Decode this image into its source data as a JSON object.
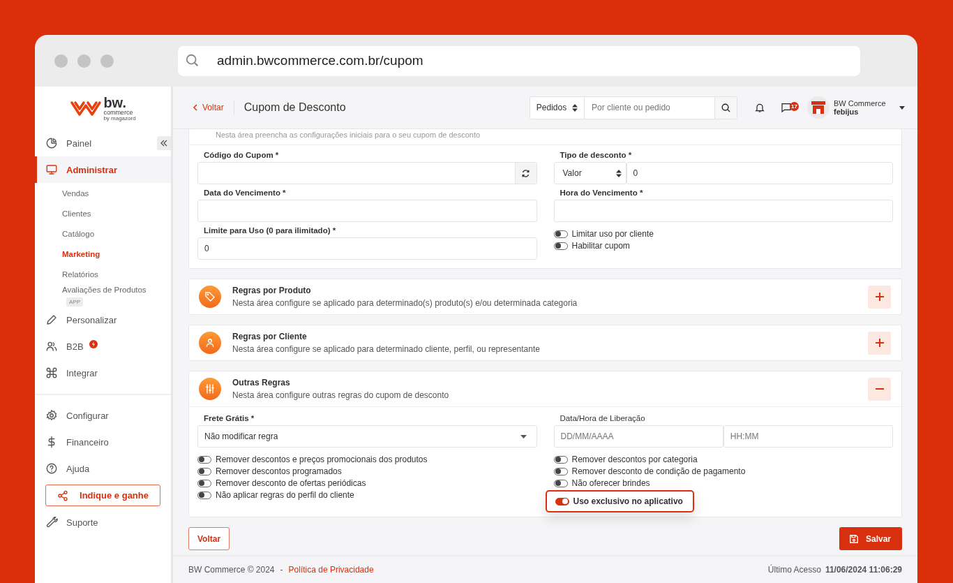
{
  "browser": {
    "url": "admin.bwcommerce.com.br/cupom"
  },
  "logo": {
    "name": "bw.",
    "tagline": "commerce",
    "byline": "by magazord"
  },
  "sidebar": {
    "main": [
      {
        "label": "Painel",
        "selected": false,
        "flagged": false
      },
      {
        "label": "Administrar",
        "selected": true,
        "flagged": false,
        "children": [
          {
            "label": "Vendas",
            "selected": false
          },
          {
            "label": "Clientes",
            "selected": false
          },
          {
            "label": "Catálogo",
            "selected": false
          },
          {
            "label": "Marketing",
            "selected": true
          },
          {
            "label": "Relatórios",
            "selected": false
          },
          {
            "label": "Avaliações de Produtos",
            "selected": false,
            "badge": "APP"
          }
        ]
      },
      {
        "label": "Personalizar",
        "selected": false,
        "flagged": false
      },
      {
        "label": "B2B",
        "selected": false,
        "flagged": true
      },
      {
        "label": "Integrar",
        "selected": false,
        "flagged": false
      }
    ],
    "secondary": [
      {
        "label": "Configurar",
        "selected": false
      },
      {
        "label": "Financeiro",
        "selected": false
      },
      {
        "label": "Ajuda",
        "selected": false
      }
    ],
    "referral_button": "Indique e ganhe",
    "support": [
      {
        "label": "Suporte",
        "selected": false
      }
    ]
  },
  "header": {
    "back_link": "Voltar",
    "title": "Cupom de Desconto",
    "search": {
      "scope": "Pedidos",
      "placeholder": "Por cliente ou pedido"
    },
    "messages_badge": "17",
    "account": {
      "name": "BW Commerce",
      "user": "febijus"
    }
  },
  "general": {
    "description": "Nesta área preencha as configurações iniciais para o seu cupom de desconto",
    "coupon_code": {
      "label": "Código do Cupom *"
    },
    "discount_type": {
      "label": "Tipo de desconto *",
      "type": "Valor",
      "value": "0"
    },
    "expiry_date": {
      "label": "Data do Vencimento *"
    },
    "expiry_time": {
      "label": "Hora do Vencimento *"
    },
    "usage_limit": {
      "label": "Limite para Uso (0 para ilimitado) *",
      "value": "0"
    },
    "toggles": [
      {
        "label": "Limitar uso por cliente",
        "on": false
      },
      {
        "label": "Habilitar cupom",
        "on": false
      }
    ]
  },
  "sections": [
    {
      "title": "Regras por Produto",
      "description": "Nesta área configure se aplicado para determinado(s) produto(s) e/ou determinada categoria",
      "expanded": false
    },
    {
      "title": "Regras por Cliente",
      "description": "Nesta área configure se aplicado para determinado cliente, perfil, ou representante",
      "expanded": false
    },
    {
      "title": "Outras Regras",
      "description": "Nesta área configure outras regras do cupom de desconto",
      "expanded": true,
      "rules": {
        "free_shipping": {
          "label": "Frete Grátis *",
          "value": "Não modificar regra"
        },
        "release": {
          "label": "Data/Hora de Liberação",
          "date_placeholder": "DD/MM/AAAA",
          "time_placeholder": "HH:MM"
        },
        "toggles_left": [
          {
            "label": "Remover descontos e preços promocionais dos produtos",
            "on": false,
            "highlighted": false
          },
          {
            "label": "Remover descontos programados",
            "on": false,
            "highlighted": false
          },
          {
            "label": "Remover desconto de ofertas periódicas",
            "on": false,
            "highlighted": false
          },
          {
            "label": "Não aplicar regras do perfil do cliente",
            "on": false,
            "highlighted": false
          }
        ],
        "toggles_right": [
          {
            "label": "Remover descontos por categoria",
            "on": false,
            "highlighted": false
          },
          {
            "label": "Remover desconto de condição de pagamento",
            "on": false,
            "highlighted": false
          },
          {
            "label": "Não oferecer brindes",
            "on": false,
            "highlighted": false
          },
          {
            "label": "Uso exclusivo no aplicativo",
            "on": true,
            "highlighted": true
          }
        ]
      }
    }
  ],
  "actions": {
    "back": "Voltar",
    "save": "Salvar"
  },
  "footer": {
    "copyright": "BW Commerce © 2024",
    "separator": "-",
    "privacy_link": "Política de Privacidade",
    "last_access_label": "Último Acesso",
    "last_access": "11/06/2024 11:06:29"
  }
}
